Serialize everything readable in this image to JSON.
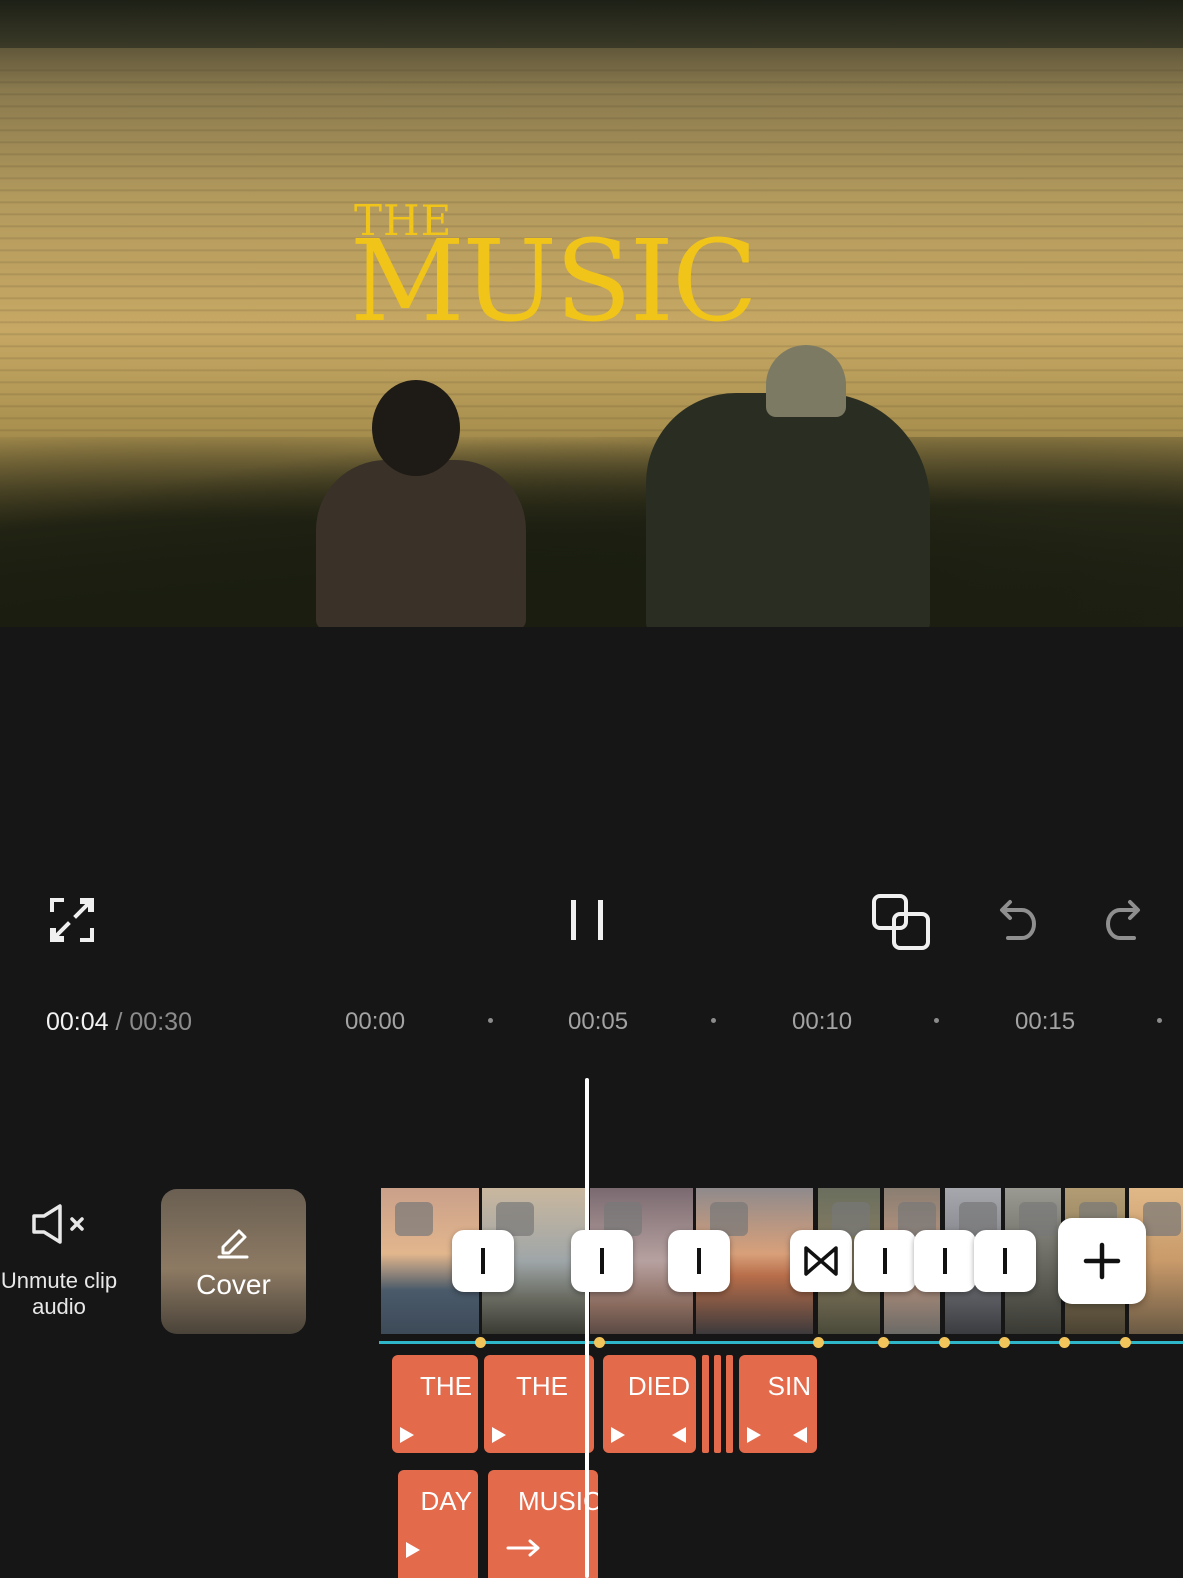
{
  "preview": {
    "title_line1": "THE",
    "title_line2": "MUSIC",
    "title_color": "#f0c419"
  },
  "controls": {
    "fullscreen_icon": "fullscreen-icon",
    "play_pause_icon": "pause-icon",
    "overlay_icon": "overlay-icon",
    "undo_icon": "undo-icon",
    "redo_icon": "redo-icon"
  },
  "timeline": {
    "current_time": "00:04",
    "separator": " / ",
    "total_time": "00:30",
    "ticks": [
      "00:00",
      "00:05",
      "00:10",
      "00:15"
    ]
  },
  "tools": {
    "unmute_label_line1": "Unmute clip",
    "unmute_label_line2": "audio",
    "cover_label": "Cover"
  },
  "text_track_1": [
    {
      "label": "THE"
    },
    {
      "label": "THE"
    },
    {
      "label": "DIED"
    },
    {
      "label": "SIN"
    }
  ],
  "text_track_2": [
    {
      "label": "DAY"
    },
    {
      "label": "MUSIC"
    }
  ],
  "colors": {
    "background": "#161616",
    "text_clip": "#e46a4c",
    "audio_line": "#2fb6c9",
    "keyframe": "#f2c45c"
  }
}
